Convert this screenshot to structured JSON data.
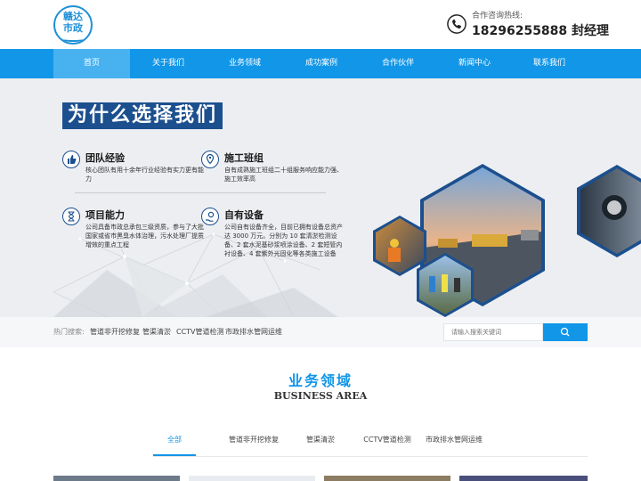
{
  "header": {
    "logo": {
      "line1": "赣达",
      "line2": "市政"
    },
    "hotline_label": "合作咨询热线:",
    "hotline_number": "18296255888 封经理"
  },
  "nav": {
    "items": [
      {
        "label": "首页",
        "active": true
      },
      {
        "label": "关于我们"
      },
      {
        "label": "业务领域"
      },
      {
        "label": "成功案例"
      },
      {
        "label": "合作伙伴"
      },
      {
        "label": "新闻中心"
      },
      {
        "label": "联系我们"
      }
    ]
  },
  "banner": {
    "headline": "为什么选择我们",
    "features": [
      {
        "title": "团队经验",
        "desc": "核心团队有用十余年行业经验有实力更有能力",
        "icon": "thumbs-up-icon"
      },
      {
        "title": "施工班组",
        "desc": "自有成熟施工班组二十组服务响应能力强、施工效率高",
        "icon": "location-pin-icon"
      },
      {
        "title": "项目能力",
        "desc": "公司具备市政总承包三级资质，参与了大批国家或省市黑臭水体治理，污水处理厂提质增效的重点工程",
        "icon": "hourglass-icon"
      },
      {
        "title": "自有设备",
        "desc": "公司自有设备齐全，目前已拥有设备总资产达 3000 万元。分别为 10 套清淤检测设备、2 套水泥基砂浆喷涂设备、2 套短管内衬设备、4 套紫外光固化等各类施工设备",
        "icon": "gear-hand-icon"
      }
    ]
  },
  "search": {
    "hot_label": "热门搜索:",
    "keywords": [
      "管道非开挖修复",
      "管渠清淤",
      "CCTV管道检测",
      "市政排水管网运维"
    ],
    "placeholder": "请输入搜索关键词"
  },
  "business": {
    "title": "业务领域",
    "subtitle": "BUSINESS AREA",
    "tabs": [
      "全部",
      "管道非开挖修复",
      "管渠清淤",
      "CCTV管道检测",
      "市政排水管网运维"
    ]
  },
  "colors": {
    "brand_blue": "#1196e8",
    "nav_active": "#48b2f0",
    "headline_bg": "#1c4f8e"
  }
}
